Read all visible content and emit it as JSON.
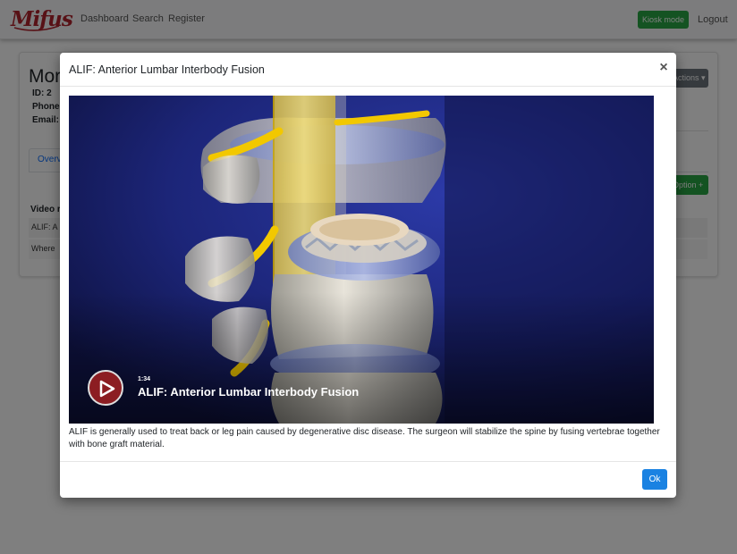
{
  "navbar": {
    "logo": "Mifus",
    "links": [
      "Dashboard",
      "Search",
      "Register"
    ],
    "kiosk_label": "Kiosk mode",
    "logout_label": "Logout"
  },
  "background": {
    "name": "Mor",
    "id": "ID: 2",
    "phone": "Phone",
    "email": "Email:",
    "tab": "Overv",
    "actions_button": "Actions ▾",
    "green_button": "Option +",
    "video_label": "Video r",
    "row1": "ALIF: A",
    "row2": "Where"
  },
  "modal": {
    "title": "ALIF: Anterior Lumbar Interbody Fusion",
    "close_symbol": "×",
    "video": {
      "duration": "1:34",
      "title": "ALIF: Anterior Lumbar Interbody Fusion"
    },
    "description": "ALIF is generally used to treat back or leg pain caused by degenerative disc disease. The surgeon will stabilize the spine by fusing vertebrae together with bone graft material.",
    "ok_label": "Ok"
  },
  "colors": {
    "brand": "#b0232c",
    "kiosk": "#28a745",
    "ok": "#1a82e2",
    "play": "#8c1d22"
  }
}
